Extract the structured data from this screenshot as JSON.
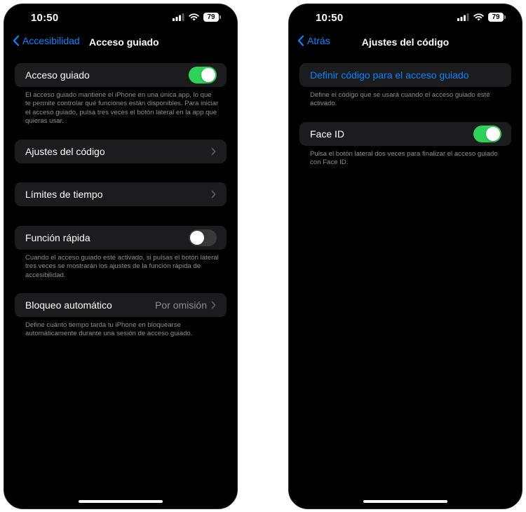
{
  "status_bar": {
    "time": "10:50",
    "battery": "79",
    "icons": [
      "cellular-signal-icon",
      "wifi-icon",
      "battery-icon"
    ]
  },
  "left_screen": {
    "back_label": "Accesibilidad",
    "title": "Acceso guiado",
    "guided_access": {
      "label": "Acceso guiado",
      "enabled": true
    },
    "guided_access_footer": "El acceso guiado mantiene el iPhone en una única app, lo que te permite controlar qué funciones están disponibles. Para iniciar el acceso guiado, pulsa tres veces el botón lateral en la app que quieras usar.",
    "passcode_settings": "Ajustes del código",
    "time_limits": "Límites de tiempo",
    "shortcut": {
      "label": "Función rápida",
      "enabled": false
    },
    "shortcut_footer": "Cuando el acceso guiado esté activado, si pulsas el botón lateral tres veces se mostrarán los ajustes de la función rápida de accesibilidad.",
    "auto_lock": {
      "label": "Bloqueo automático",
      "value": "Por omisión"
    },
    "auto_lock_footer": "Define cuánto tiempo tarda tu iPhone en bloquearse automáticamente durante una sesión de acceso guiado."
  },
  "right_screen": {
    "back_label": "Atrás",
    "title": "Ajustes del código",
    "set_passcode": "Definir código para el acceso guiado",
    "set_passcode_footer": "Define el código que se usará cuando el acceso guiado esté activado.",
    "face_id": {
      "label": "Face ID",
      "enabled": true
    },
    "face_id_footer": "Pulsa el botón lateral dos veces para finalizar el acceso guiado con Face ID."
  },
  "colors": {
    "background": "#000000",
    "cell": "#1c1c1e",
    "accent_blue": "#0a84ff",
    "toggle_on": "#30d158",
    "toggle_off": "#39393d",
    "secondary_text": "#8e8e93"
  }
}
